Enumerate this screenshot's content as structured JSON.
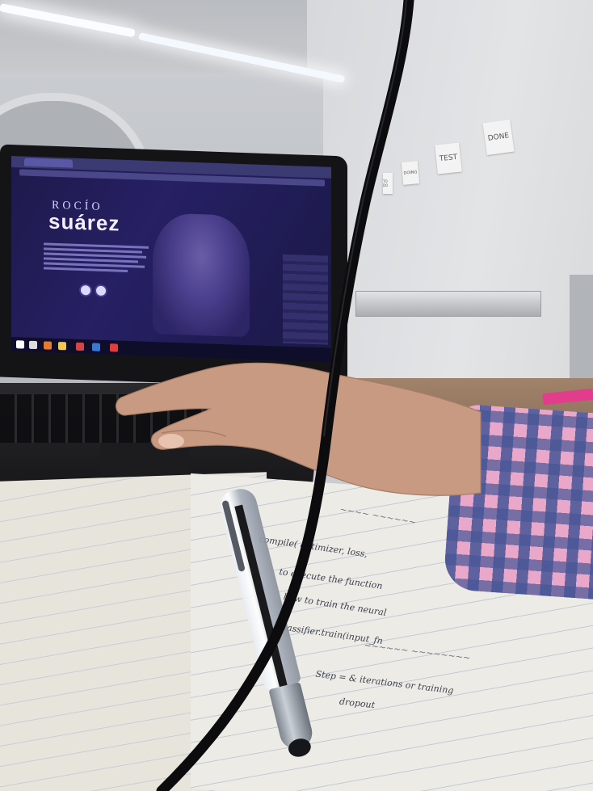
{
  "screen": {
    "site_small": "ROCÍO",
    "site_big": "suárez"
  },
  "notebook": {
    "lines": [
      "compile( optimizer, loss,",
      "to execute the function",
      "how to train the neural",
      "classifier.train(input_fn",
      "Step = &   iterations or training",
      "dropout"
    ]
  },
  "wall_notes": [
    "DONE",
    "TEST",
    "DOING",
    "TO DO"
  ],
  "colors": {
    "screen_bg": "#241f5c",
    "sleeve_pink": "#e9a8c9",
    "sleeve_blue": "#4655a0",
    "desk": "#9b7c65",
    "pink_item": "#e23d8d"
  }
}
